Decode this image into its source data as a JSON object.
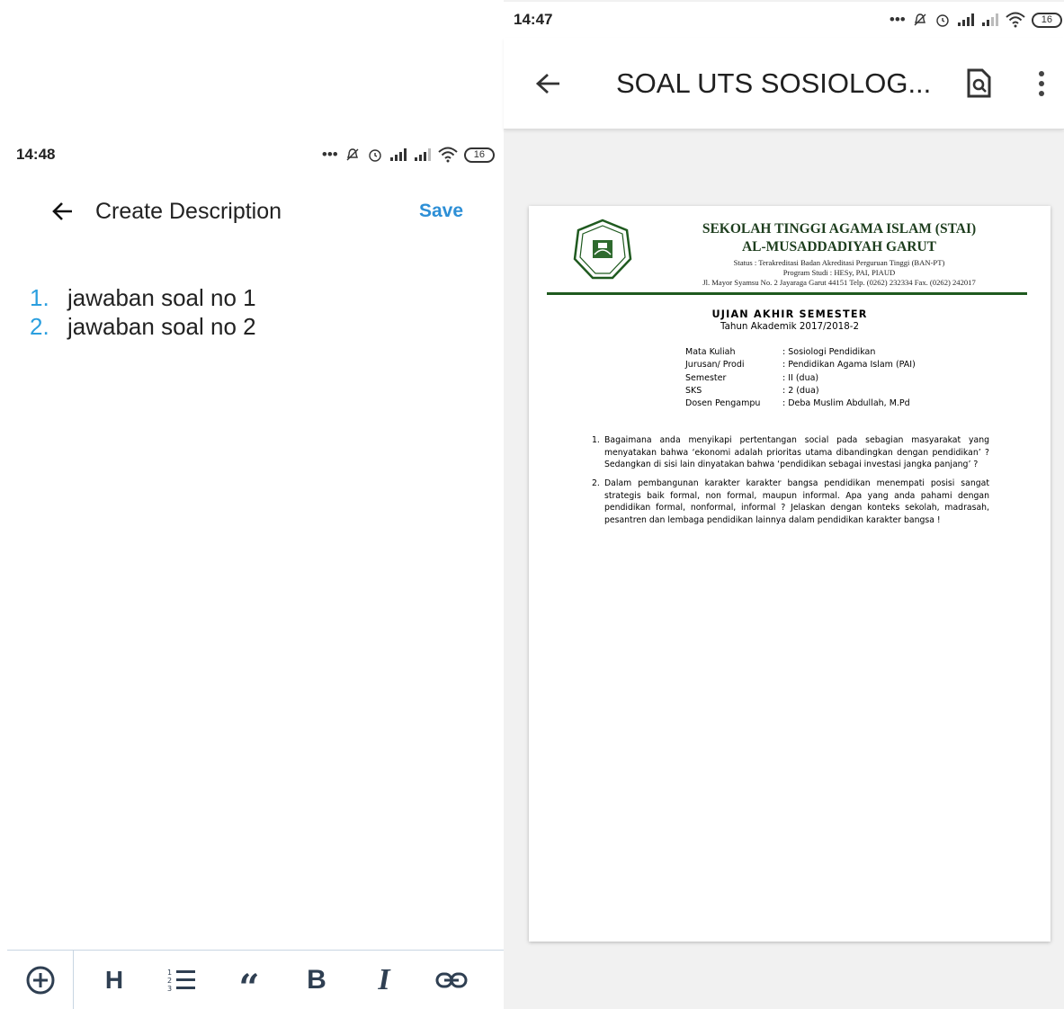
{
  "left": {
    "statusbar": {
      "time": "14:48",
      "battery": "16"
    },
    "header": {
      "title": "Create Description",
      "save_label": "Save"
    },
    "list": [
      {
        "num": "1.",
        "text": "jawaban soal no 1"
      },
      {
        "num": "2.",
        "text": "jawaban soal no 2"
      }
    ],
    "format_bar": {
      "heading": "H",
      "quote": "“",
      "bold": "B",
      "italic": "I"
    }
  },
  "right": {
    "statusbar": {
      "time": "14:47",
      "battery": "16"
    },
    "toolbar": {
      "title": "SOAL UTS SOSIOLOG..."
    },
    "document": {
      "header": {
        "line1": "SEKOLAH TINGGI AGAMA ISLAM (STAI)",
        "line2": "AL-MUSADDADIYAH GARUT",
        "status": "Status : Terakreditasi Badan Akreditasi Perguruan Tinggi (BAN-PT)",
        "program": "Program Studi : HESy, PAI, PIAUD",
        "address": "Jl. Mayor Syamsu No. 2 Jayaraga Garut 44151 Telp. (0262) 232334 Fax. (0262) 242017"
      },
      "exam_title": "UJIAN AKHIR SEMESTER",
      "exam_year": "Tahun Akademik 2017/2018-2",
      "info": [
        {
          "key": "Mata Kuliah",
          "value": ": Sosiologi Pendidikan"
        },
        {
          "key": "Jurusan/ Prodi",
          "value": ": Pendidikan Agama Islam (PAI)"
        },
        {
          "key": "Semester",
          "value": ": II (dua)"
        },
        {
          "key": "SKS",
          "value": ": 2 (dua)"
        },
        {
          "key": "Dosen Pengampu",
          "value": ": Deba Muslim Abdullah, M.Pd"
        }
      ],
      "questions": [
        {
          "num": "1.",
          "text": "Bagaimana anda menyikapi pertentangan social pada sebagian masyarakat yang menyatakan bahwa ‘ekonomi adalah prioritas utama dibandingkan dengan pendidikan’ ? Sedangkan di sisi lain dinyatakan bahwa ‘pendidikan sebagai investasi jangka panjang’ ?"
        },
        {
          "num": "2.",
          "text": "Dalam pembangunan karakter karakter bangsa pendidikan menempati posisi sangat strategis baik formal, non formal, maupun informal. Apa yang anda pahami dengan pendidikan formal, nonformal, informal ? Jelaskan dengan konteks sekolah, madrasah, pesantren dan lembaga pendidikan lainnya dalam pendidikan karakter bangsa !"
        }
      ]
    }
  },
  "colors": {
    "accent": "#2d8fd6",
    "list_number": "#2b9fdf",
    "letterhead_green": "#1f5a1f"
  }
}
